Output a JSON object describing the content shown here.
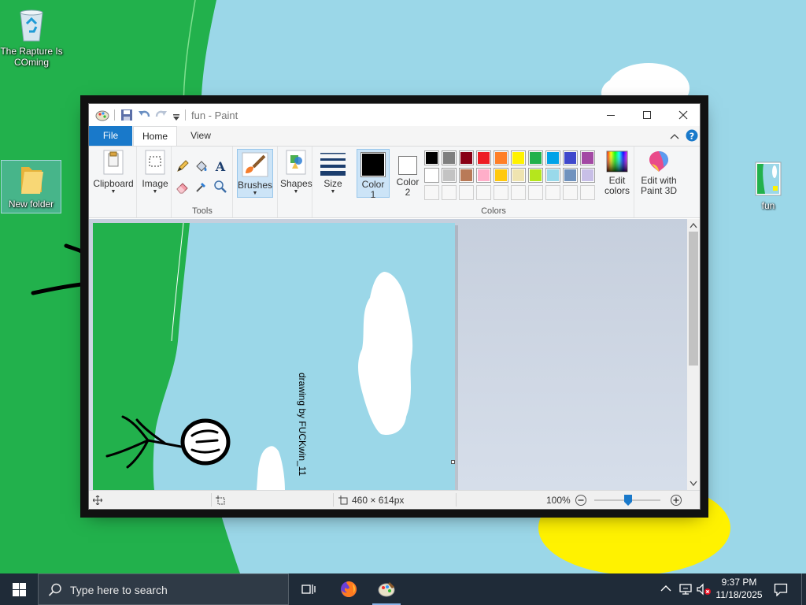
{
  "desktop": {
    "icons": [
      {
        "label": "The Rapture Is COming",
        "icon": "recycle-bin-icon"
      },
      {
        "label": "New folder",
        "icon": "folder-icon"
      },
      {
        "label": "fun",
        "icon": "image-file-icon"
      }
    ]
  },
  "paint": {
    "title": "fun - Paint",
    "tabs": {
      "file": "File",
      "home": "Home",
      "view": "View"
    },
    "ribbon": {
      "clipboard": "Clipboard",
      "image": "Image",
      "tools_group": "Tools",
      "brushes": "Brushes",
      "shapes": "Shapes",
      "size": "Size",
      "color1_line1": "Color",
      "color1_line2": "1",
      "color2_line1": "Color",
      "color2_line2": "2",
      "edit_colors_line1": "Edit",
      "edit_colors_line2": "colors",
      "paint3d_line1": "Edit with",
      "paint3d_line2": "Paint 3D",
      "colors_group": "Colors",
      "text_tool_glyph": "A"
    },
    "palette": {
      "row1": [
        "#000000",
        "#7f7f7f",
        "#880015",
        "#ed1c24",
        "#ff7f27",
        "#fff200",
        "#22b14c",
        "#00a2e8",
        "#3f48cc",
        "#a349a4"
      ],
      "row2": [
        "#ffffff",
        "#c3c3c3",
        "#b97a57",
        "#ffaec9",
        "#ffc90e",
        "#efe4b0",
        "#b5e61d",
        "#99d9ea",
        "#7092be",
        "#c8bfe7"
      ],
      "row3": [
        "",
        "",
        "",
        "",
        "",
        "",
        "",
        "",
        "",
        ""
      ]
    },
    "color1": "#000000",
    "color2": "#ffffff",
    "canvas_text": "drawing by FUCKwin_11",
    "status": {
      "image_size": "460 × 614px",
      "zoom": "100%"
    }
  },
  "taskbar": {
    "search_placeholder": "Type here to search",
    "time": "9:37 PM",
    "date": "11/18/2025"
  }
}
